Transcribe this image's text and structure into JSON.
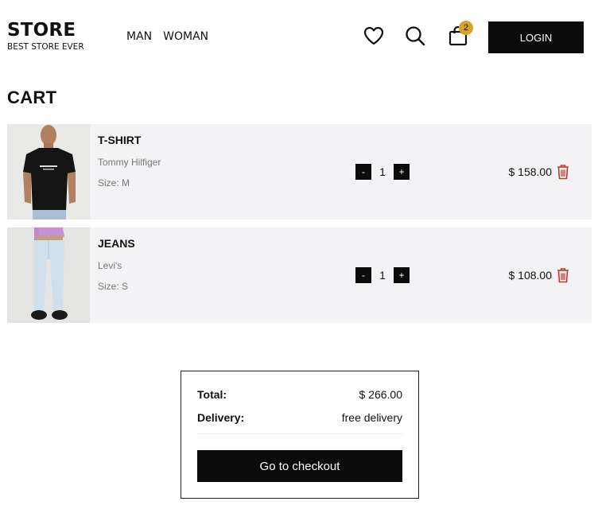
{
  "header": {
    "brand_name": "STORE",
    "brand_tagline": "BEST STORE EVER",
    "nav": [
      {
        "label": "MAN"
      },
      {
        "label": "WOMAN"
      }
    ],
    "cart_count": "2",
    "login_label": "LOGIN",
    "icons": [
      "heart-icon",
      "search-icon",
      "shopping-bag-icon"
    ]
  },
  "page": {
    "title": "CART"
  },
  "cart": {
    "items": [
      {
        "name": "T-SHIRT",
        "brand": "Tommy Hilfiger",
        "size": "Size: M",
        "quantity": "1",
        "price": "$ 158.00",
        "minus": "-",
        "plus": "+"
      },
      {
        "name": "JEANS",
        "brand": "Levi's",
        "size": "Size: S",
        "quantity": "1",
        "price": "$ 108.00",
        "minus": "-",
        "plus": "+"
      }
    ]
  },
  "summary": {
    "total_label": "Total:",
    "total_value": "$ 266.00",
    "delivery_label": "Delivery:",
    "delivery_value": "free delivery",
    "checkout_label": "Go to checkout"
  },
  "colors": {
    "badge": "#d5a425",
    "trash": "#c0392b",
    "dark": "#0b0b0b",
    "item_bg": "#f3f2f4"
  }
}
